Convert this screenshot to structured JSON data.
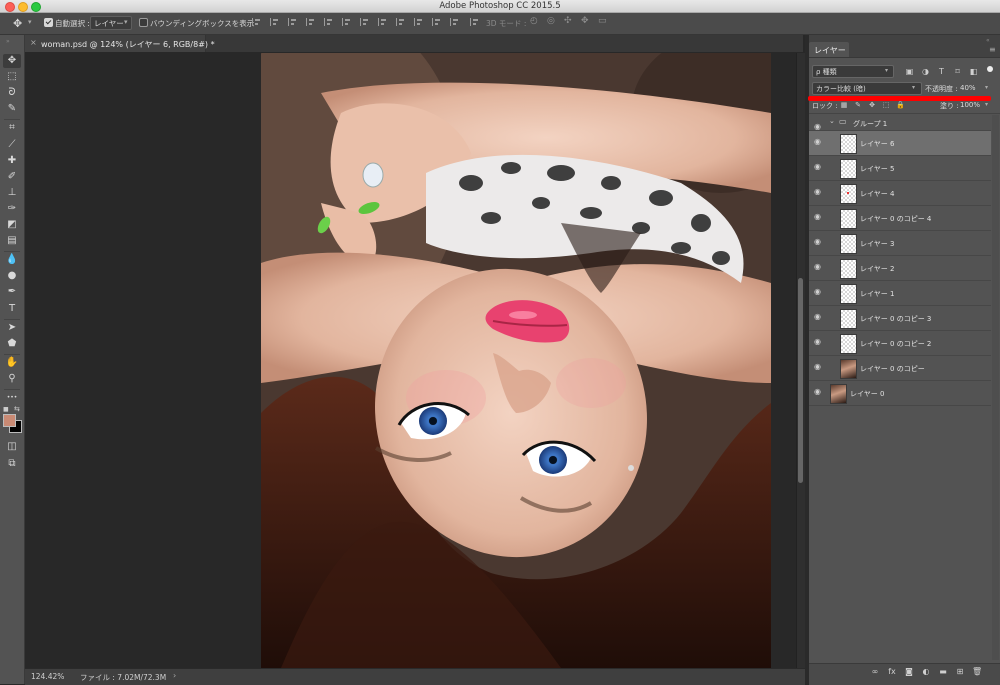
{
  "window": {
    "app_title": "Adobe Photoshop CC 2015.5"
  },
  "options_bar": {
    "move_glyph": "✥",
    "caret": "▾",
    "auto_select_label": "自動選択 :",
    "auto_select_checked": true,
    "auto_select_target": "レイヤー",
    "bounding_box_label": "バウンディングボックスを表示",
    "bounding_box_checked": false,
    "mode_3d_label": "3D モード :",
    "mode_3d_glyphs": [
      "◴",
      "◎",
      "✣",
      "✥",
      "▭"
    ]
  },
  "document": {
    "close_glyph": "×",
    "tab_title": "woman.psd @ 124% (レイヤー 6, RGB/8#) *"
  },
  "status_bar": {
    "zoom": "124.42%",
    "file_info": "ファイル : 7.02M/72.3M",
    "arrow": "›"
  },
  "tools": [
    {
      "name": "move-tool-icon",
      "glyph": "✥"
    },
    {
      "name": "marquee-tool-icon",
      "glyph": "⬚"
    },
    {
      "name": "lasso-tool-icon",
      "glyph": "ᘐ"
    },
    {
      "name": "quick-select-tool-icon",
      "glyph": "✎"
    },
    {
      "name": "crop-tool-icon",
      "glyph": "⌗"
    },
    {
      "name": "eyedropper-tool-icon",
      "glyph": "⟋"
    },
    {
      "name": "healing-brush-tool-icon",
      "glyph": "✚"
    },
    {
      "name": "brush-tool-icon",
      "glyph": "✐"
    },
    {
      "name": "stamp-tool-icon",
      "glyph": "⊥"
    },
    {
      "name": "history-brush-tool-icon",
      "glyph": "✑"
    },
    {
      "name": "eraser-tool-icon",
      "glyph": "◩"
    },
    {
      "name": "gradient-tool-icon",
      "glyph": "▤"
    },
    {
      "name": "blur-tool-icon",
      "glyph": "💧"
    },
    {
      "name": "dodge-tool-icon",
      "glyph": "●"
    },
    {
      "name": "pen-tool-icon",
      "glyph": "✒"
    },
    {
      "name": "type-tool-icon",
      "glyph": "T"
    },
    {
      "name": "path-select-tool-icon",
      "glyph": "➤"
    },
    {
      "name": "shape-tool-icon",
      "glyph": "⬟"
    },
    {
      "name": "hand-tool-icon",
      "glyph": "✋"
    },
    {
      "name": "zoom-tool-icon",
      "glyph": "⚲"
    },
    {
      "name": "more-tools-icon",
      "glyph": "•••"
    }
  ],
  "bottom_tools": [
    {
      "name": "quick-mask-icon",
      "glyph": "◫"
    },
    {
      "name": "screen-mode-icon",
      "glyph": "⧉"
    }
  ],
  "colors": {
    "foreground": "#c98a74",
    "background": "#000000"
  },
  "layers_panel": {
    "tab_label": "レイヤー",
    "menu_glyph": "≡",
    "filter_label": "ρ 種類",
    "filter_icons": [
      {
        "name": "filter-pixel-icon",
        "glyph": "▣"
      },
      {
        "name": "filter-adjustment-icon",
        "glyph": "◑"
      },
      {
        "name": "filter-type-icon",
        "glyph": "T"
      },
      {
        "name": "filter-shape-icon",
        "glyph": "⌑"
      },
      {
        "name": "filter-smart-object-icon",
        "glyph": "◧"
      }
    ],
    "blend_mode": "カラー比較 (暗)",
    "opacity_label": "不透明度 :",
    "opacity_value": "40%",
    "lock_label": "ロック :",
    "lock_icons": [
      {
        "name": "lock-transparent-icon",
        "glyph": "▦"
      },
      {
        "name": "lock-pixels-icon",
        "glyph": "✎"
      },
      {
        "name": "lock-position-icon",
        "glyph": "✥"
      },
      {
        "name": "lock-artboard-icon",
        "glyph": "⬚"
      },
      {
        "name": "lock-all-icon",
        "glyph": "🔒"
      }
    ],
    "fill_label": "塗り :",
    "fill_value": "100%",
    "eye_glyph": "◉",
    "group": {
      "name": "グループ 1",
      "expand_glyph": "⌄",
      "folder_glyph": "▭"
    },
    "layers": [
      {
        "name": "レイヤー 6",
        "thumb": "transparent",
        "selected": true,
        "indented": true
      },
      {
        "name": "レイヤー 5",
        "thumb": "transparent",
        "selected": false,
        "indented": true
      },
      {
        "name": "レイヤー 4",
        "thumb": "dot",
        "selected": false,
        "indented": true
      },
      {
        "name": "レイヤー 0 のコピー 4",
        "thumb": "transparent",
        "selected": false,
        "indented": true
      },
      {
        "name": "レイヤー 3",
        "thumb": "transparent",
        "selected": false,
        "indented": true
      },
      {
        "name": "レイヤー 2",
        "thumb": "transparent",
        "selected": false,
        "indented": true
      },
      {
        "name": "レイヤー 1",
        "thumb": "transparent",
        "selected": false,
        "indented": true
      },
      {
        "name": "レイヤー 0 のコピー 3",
        "thumb": "transparent",
        "selected": false,
        "indented": true
      },
      {
        "name": "レイヤー 0 のコピー 2",
        "thumb": "transparent",
        "selected": false,
        "indented": true
      },
      {
        "name": "レイヤー 0 のコピー",
        "thumb": "photo",
        "selected": false,
        "indented": true
      },
      {
        "name": "レイヤー 0",
        "thumb": "photo",
        "selected": false,
        "indented": false
      }
    ],
    "bottom_icons": [
      {
        "name": "link-layers-icon",
        "glyph": "∞"
      },
      {
        "name": "layer-style-icon",
        "glyph": "fx"
      },
      {
        "name": "add-mask-icon",
        "glyph": "◙"
      },
      {
        "name": "adjustment-layer-icon",
        "glyph": "◐"
      },
      {
        "name": "new-group-icon",
        "glyph": "▬"
      },
      {
        "name": "new-layer-icon",
        "glyph": "⊞"
      },
      {
        "name": "delete-layer-icon",
        "glyph": "🗑"
      }
    ]
  }
}
